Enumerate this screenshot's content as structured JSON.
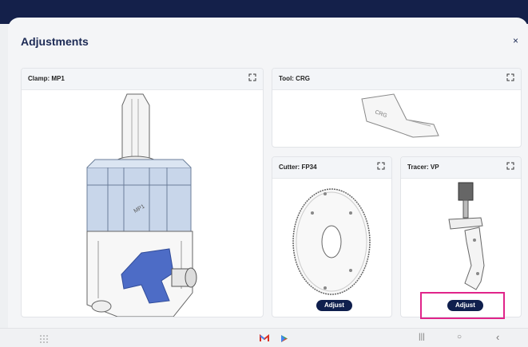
{
  "modal": {
    "title": "Adjustments",
    "close_label": "×"
  },
  "cards": {
    "clamp": {
      "title": "Clamp: MP1",
      "part_label": "MP1"
    },
    "tool": {
      "title": "Tool: CRG",
      "part_label": "CRG"
    },
    "cutter": {
      "title": "Cutter: FP34",
      "adjust_label": "Adjust"
    },
    "tracer": {
      "title": "Tracer: VP",
      "adjust_label": "Adjust"
    }
  },
  "navbar": {
    "recent": "|||",
    "home": "○",
    "back": "‹"
  },
  "colors": {
    "brand": "#14204a",
    "button": "#0f1f4d",
    "highlight": "#e0248a",
    "clamp_blue": "#4d6cc6"
  },
  "icons": [
    "expand-icon",
    "close-icon",
    "apps-grid-icon",
    "gmail-icon",
    "play-store-icon"
  ]
}
